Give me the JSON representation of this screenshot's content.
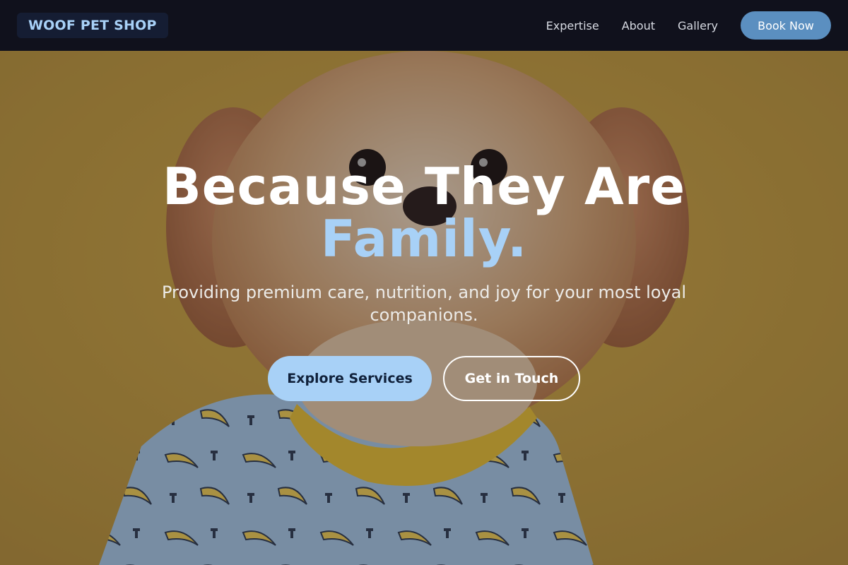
{
  "brand": {
    "logo_text": "WOOF PET SHOP"
  },
  "nav": {
    "links": [
      "Expertise",
      "About",
      "Gallery"
    ],
    "cta_label": "Book Now"
  },
  "hero": {
    "headline": "Because They Are",
    "headline_accent": "Family.",
    "subtitle": "Providing premium care, nutrition, and joy for your most loyal companions.",
    "primary_button": "Explore Services",
    "secondary_button": "Get in Touch",
    "background_image": "photo of a fluffy small dog wearing a blue banana-print shirt on a mustard yellow backdrop"
  },
  "colors": {
    "accent": "#a8d1f7",
    "nav_background": "#10111c",
    "book_button": "#5b8fc0",
    "backdrop_yellow": "#c69f3c"
  }
}
